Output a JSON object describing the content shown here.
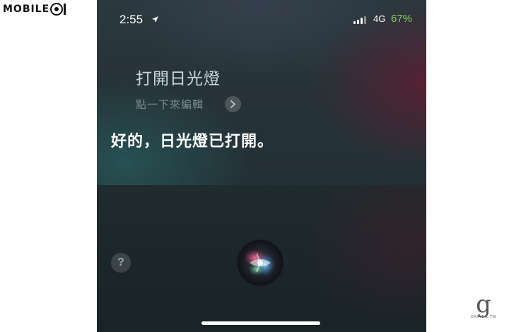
{
  "watermark": {
    "logo_text": "MOBILE01",
    "logo_main": "MOBILE",
    "logo_suffix": "01",
    "corner_mark": "g",
    "corner_text": "GARYNIL.TW"
  },
  "status_bar": {
    "time": "2:55",
    "network": "4G",
    "battery": "67%",
    "battery_color": "#7fd36a"
  },
  "siri": {
    "query": "打開日光燈",
    "edit_hint": "點一下來編輯",
    "response": "好的，日光燈已打開。",
    "help_label": "?"
  },
  "icons": [
    "location-arrow-icon",
    "signal-bars-icon",
    "chevron-right-icon",
    "help-icon",
    "siri-orb-icon"
  ]
}
